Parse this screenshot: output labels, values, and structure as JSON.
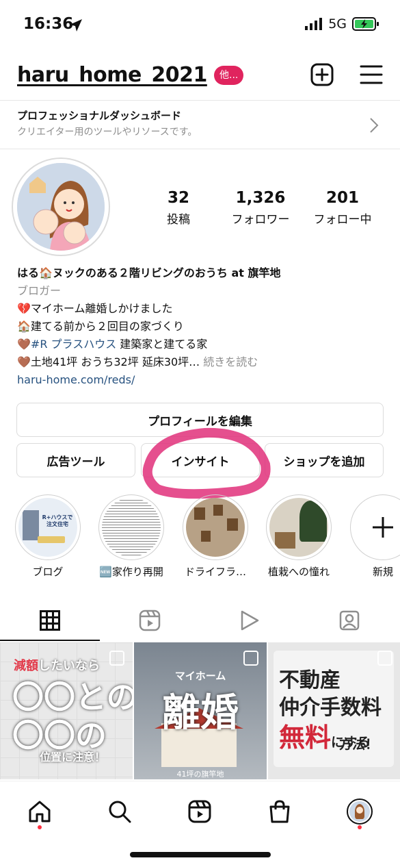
{
  "status": {
    "time": "16:36",
    "network": "5G"
  },
  "header": {
    "username": "haru_home_2021",
    "badge": "他..."
  },
  "dashboard": {
    "title": "プロフェッショナルダッシュボード",
    "subtitle": "クリエイター用のツールやリソースです。"
  },
  "stats": [
    {
      "value": "32",
      "label": "投稿"
    },
    {
      "value": "1,326",
      "label": "フォロワー"
    },
    {
      "value": "201",
      "label": "フォロー中"
    }
  ],
  "bio": {
    "name": "はる🏠ヌックのある２階リビングのおうち at 旗竿地",
    "category": "ブロガー",
    "line1": "💔マイホーム離婚しかけました",
    "line2": "🏠建てる前から２回目の家づくり",
    "line3_prefix": "🤎",
    "line3_tag": "#R プラスハウス",
    "line3_rest": " 建築家と建てる家",
    "line4": "🤎土地41坪 おうち32坪 延床30坪…",
    "more": "続きを読む",
    "link": "haru-home.com/reds/"
  },
  "buttons": {
    "edit": "プロフィールを編集",
    "ads": "広告ツール",
    "insights": "インサイト",
    "shop": "ショップを追加"
  },
  "highlights": [
    {
      "label": "ブログ",
      "cover_text": "R+ハウスで注文住宅"
    },
    {
      "label": "🆕家作り再開"
    },
    {
      "label": "ドライフラ…"
    },
    {
      "label": "植栽への憧れ"
    },
    {
      "label": "新規"
    }
  ],
  "posts": [
    {
      "t1": "減額",
      "t1b": "したいなら",
      "t2": "〇〇との",
      "t3": "〇〇の",
      "t4": "位置に注意！"
    },
    {
      "t1": "マイホーム",
      "t2": "離婚",
      "t3": "41坪の旗竿地"
    },
    {
      "t1": "不動産",
      "t2": "仲介手数料",
      "t3": "無料",
      "t4": "にする",
      "t5": "方法！"
    }
  ],
  "colors": {
    "accent_pink": "#e0245e",
    "link_blue": "#26517f",
    "highlighter": "#e0307a",
    "notif": "#ff3040"
  }
}
